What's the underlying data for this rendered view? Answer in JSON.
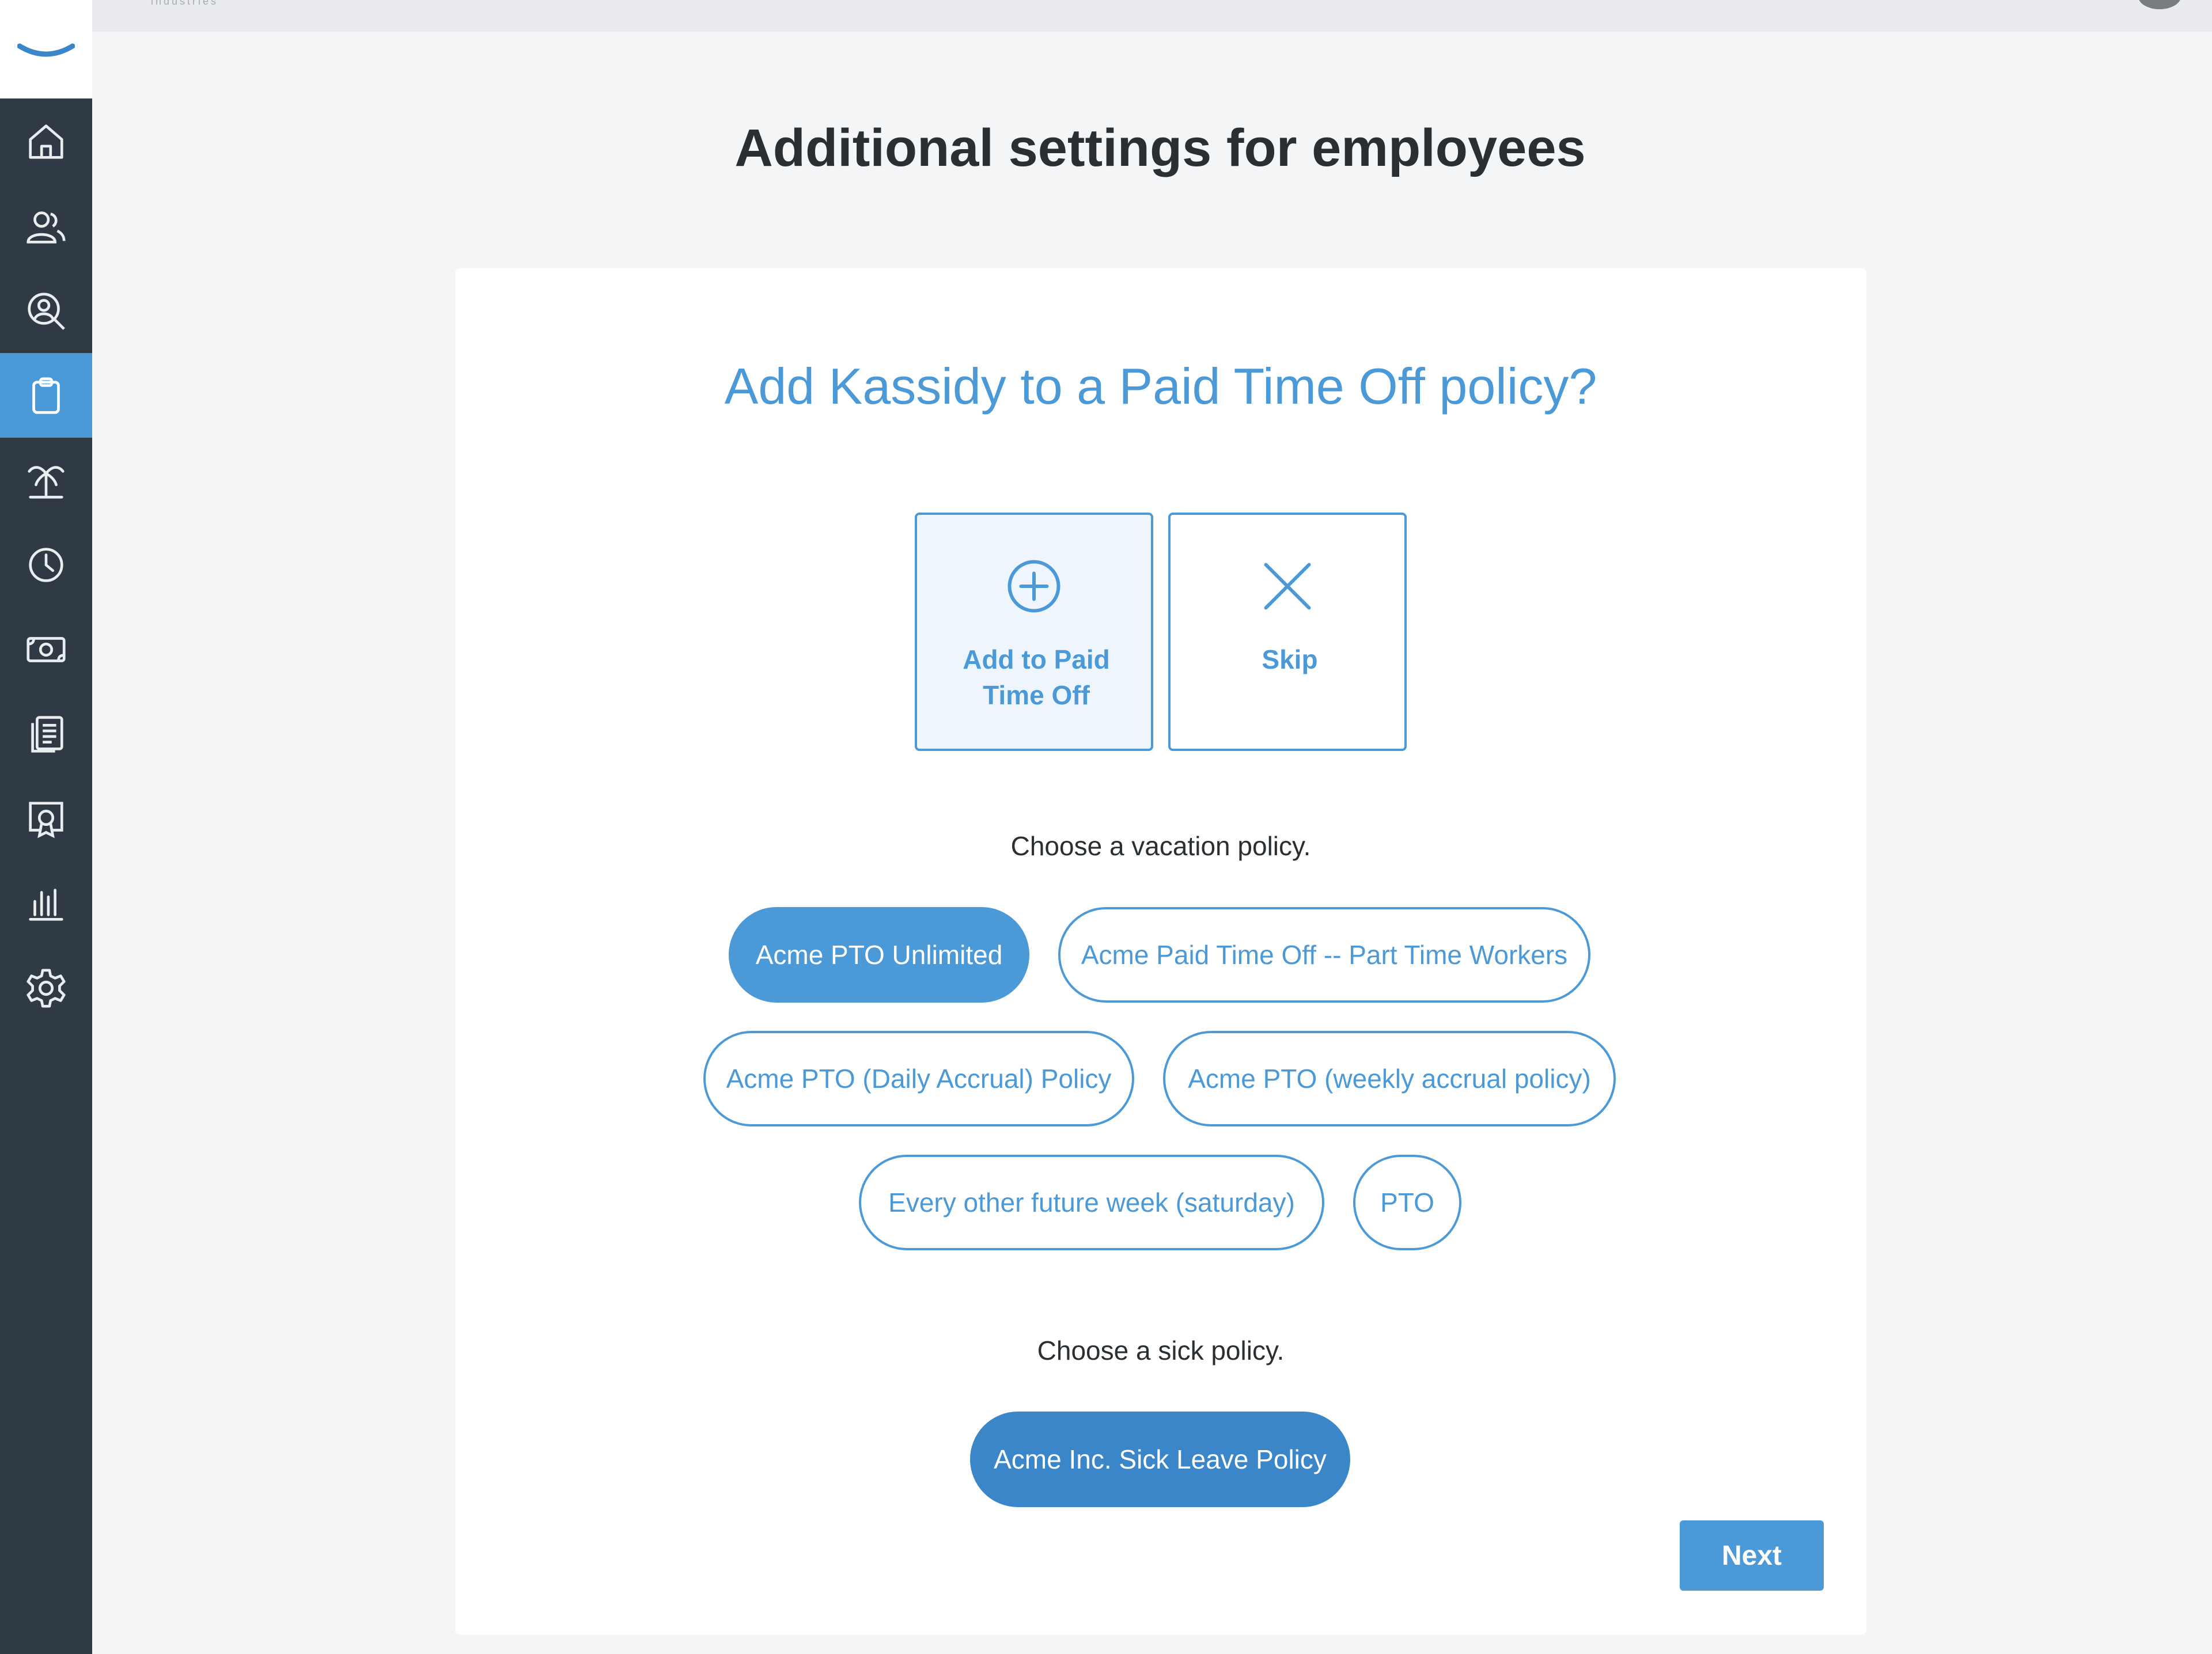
{
  "topbar": {
    "brand_text": "industries"
  },
  "page": {
    "title": "Additional settings for employees"
  },
  "card": {
    "question": "Add Kassidy to a Paid Time Off policy?",
    "choices": {
      "add_label": "Add to Paid Time Off",
      "skip_label": "Skip"
    },
    "vacation_prompt": "Choose a vacation policy.",
    "vacation_policies": [
      "Acme PTO Unlimited",
      "Acme Paid Time Off -- Part Time Workers",
      "Acme PTO (Daily Accrual) Policy",
      "Acme PTO (weekly accrual policy)",
      "Every other future week (saturday)",
      "PTO"
    ],
    "vacation_selected": "Acme PTO Unlimited",
    "sick_prompt": "Choose a sick policy.",
    "sick_policies": [
      "Acme Inc. Sick Leave Policy"
    ],
    "sick_selected": "Acme Inc. Sick Leave Policy",
    "next_label": "Next"
  },
  "sidebar": {
    "items": [
      {
        "icon": "home-icon"
      },
      {
        "icon": "people-icon"
      },
      {
        "icon": "search-person-icon"
      },
      {
        "icon": "clipboard-icon",
        "active": true
      },
      {
        "icon": "palm-tree-icon"
      },
      {
        "icon": "clock-icon"
      },
      {
        "icon": "money-icon"
      },
      {
        "icon": "documents-icon"
      },
      {
        "icon": "certificate-icon"
      },
      {
        "icon": "bar-chart-icon"
      },
      {
        "icon": "gear-icon"
      }
    ]
  },
  "colors": {
    "accent": "#4b9ad7",
    "sidebar": "#2f3a44",
    "background": "#f4f5f7"
  }
}
